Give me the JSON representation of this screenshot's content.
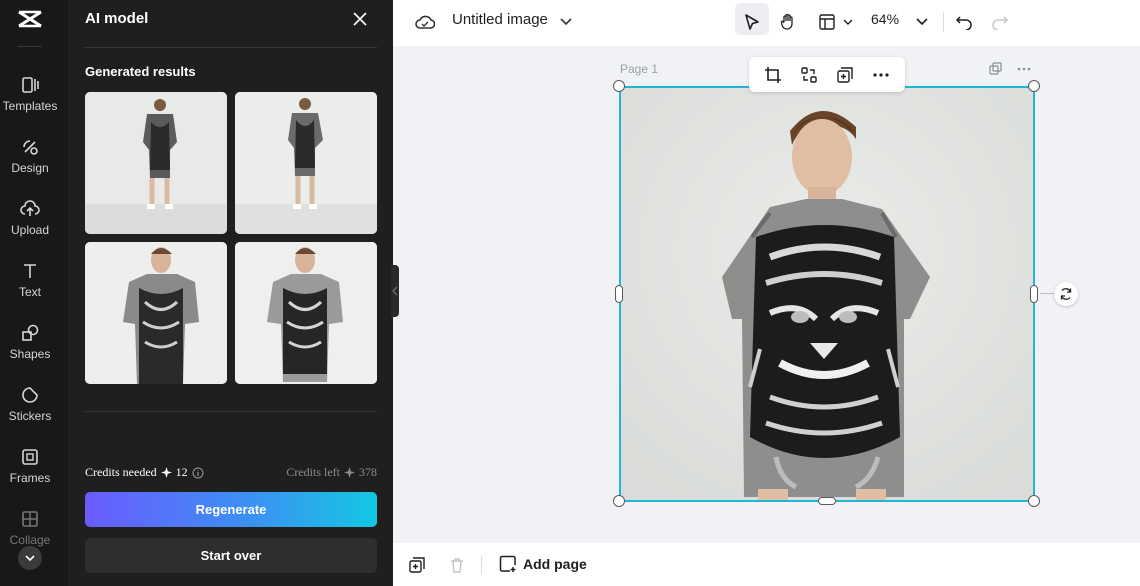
{
  "rail": {
    "items": [
      {
        "label": "Templates",
        "icon": "templates-icon"
      },
      {
        "label": "Design",
        "icon": "design-icon"
      },
      {
        "label": "Upload",
        "icon": "upload-icon"
      },
      {
        "label": "Text",
        "icon": "text-icon"
      },
      {
        "label": "Shapes",
        "icon": "shapes-icon"
      },
      {
        "label": "Stickers",
        "icon": "stickers-icon"
      },
      {
        "label": "Frames",
        "icon": "frames-icon"
      },
      {
        "label": "Collage",
        "icon": "collage-icon"
      }
    ]
  },
  "panel": {
    "title": "AI model",
    "section_title": "Generated results",
    "credits_needed_label": "Credits needed",
    "credits_needed_value": "12",
    "credits_left_label": "Credits left",
    "credits_left_value": "378",
    "regenerate_label": "Regenerate",
    "start_over_label": "Start over"
  },
  "topbar": {
    "doc_title": "Untitled image",
    "zoom": "64%"
  },
  "canvas": {
    "page_label": "Page 1"
  },
  "bottombar": {
    "add_page_label": "Add page"
  },
  "colors": {
    "accent_selection": "#20b6d6",
    "regen_gradient_start": "#6a5cff",
    "regen_gradient_end": "#14c8e2"
  }
}
